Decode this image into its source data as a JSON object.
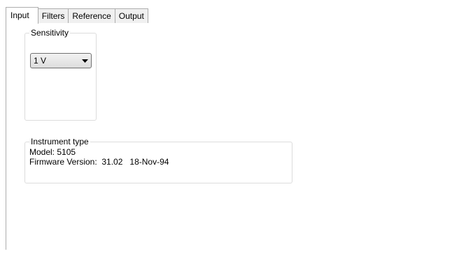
{
  "tabs": [
    {
      "label": "Input",
      "active": true
    },
    {
      "label": "Filters",
      "active": false
    },
    {
      "label": "Reference",
      "active": false
    },
    {
      "label": "Output",
      "active": false
    }
  ],
  "sensitivity": {
    "title": "Sensitivity",
    "selected": "1 V"
  },
  "instrument": {
    "title": "Instrument type",
    "model_label": "Model:",
    "model_value": "5105",
    "firmware_label": "Firmware Version:",
    "firmware_version": "31.02",
    "firmware_date": "18-Nov-94"
  },
  "icons": {
    "dropdown": "chevron-down-icon"
  },
  "colors": {
    "border": "#adadad",
    "group_border": "#dcdcdc",
    "tab_inactive_bg": "#f0f0f0"
  }
}
